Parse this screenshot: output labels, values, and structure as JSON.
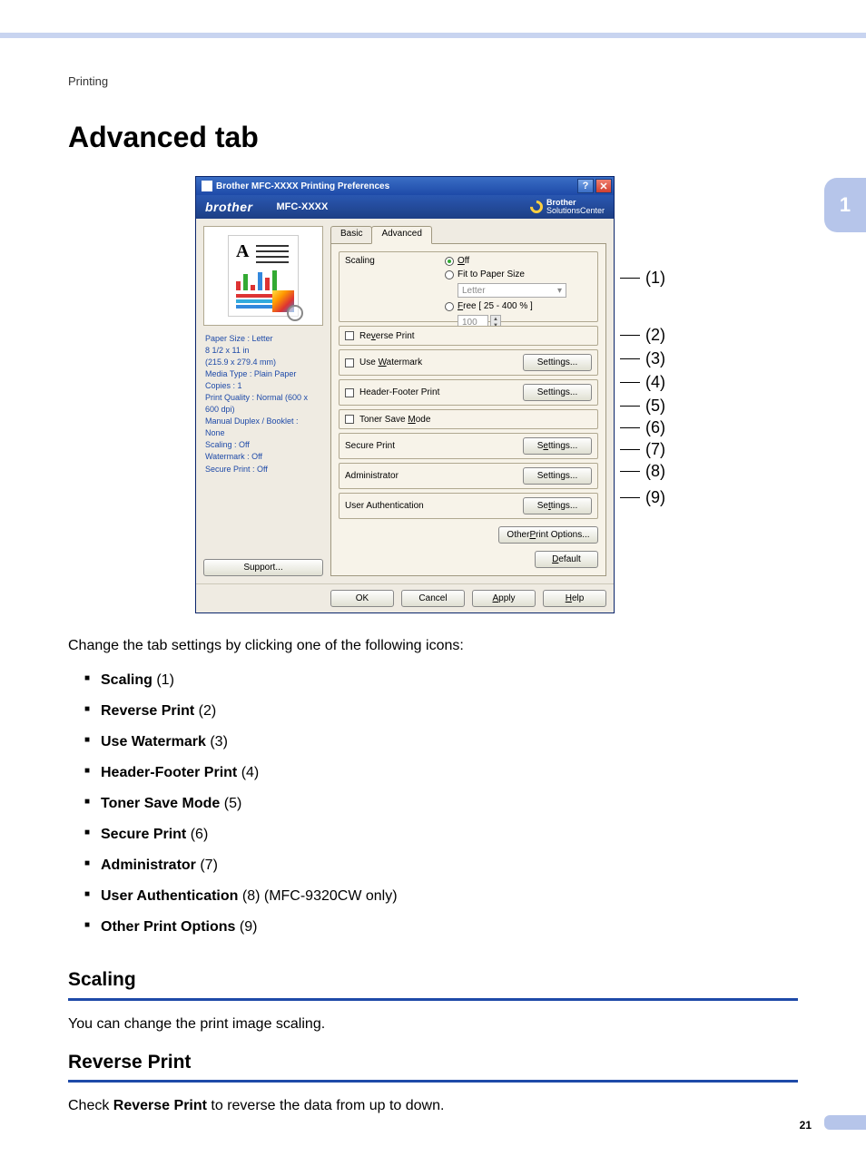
{
  "breadcrumb": "Printing",
  "heading": "Advanced tab",
  "side_chapter": "1",
  "page_number": "21",
  "window": {
    "title": "Brother MFC-XXXX Printing Preferences",
    "brand_left": "brother",
    "brand_mid": "MFC-XXXX",
    "brand_right_top": "Brother",
    "brand_right_bot": "SolutionsCenter",
    "tabs": {
      "basic": "Basic",
      "advanced": "Advanced"
    },
    "info": {
      "paper_size": "Paper Size : Letter",
      "dims": "8 1/2 x 11 in",
      "dims_mm": "(215.9 x 279.4 mm)",
      "media": "Media Type : Plain Paper",
      "copies": "Copies : 1",
      "quality": "Print Quality : Normal (600 x 600 dpi)",
      "duplex_lbl": "Manual Duplex / Booklet :",
      "duplex_val": "None",
      "scaling": "Scaling : Off",
      "watermark": "Watermark : Off",
      "secure": "Secure Print : Off"
    },
    "scaling": {
      "label": "Scaling",
      "off": "Off",
      "fit": "Fit to Paper Size",
      "fit_value": "Letter",
      "free": "Free [ 25 - 400 % ]",
      "free_value": "100"
    },
    "rows": {
      "reverse": "Reverse Print",
      "watermark": "Use Watermark",
      "headerfooter": "Header-Footer Print",
      "toner": "Toner Save Mode",
      "secure": "Secure Print",
      "admin": "Administrator",
      "userauth": "User Authentication"
    },
    "settings_btn": "Settings...",
    "other_options_btn": "Other Print Options...",
    "default_btn": "Default",
    "support_btn": "Support...",
    "footer": {
      "ok": "OK",
      "cancel": "Cancel",
      "apply": "Apply",
      "help": "Help"
    }
  },
  "callouts": {
    "c1": "(1)",
    "c2": "(2)",
    "c3": "(3)",
    "c4": "(4)",
    "c5": "(5)",
    "c6": "(6)",
    "c7": "(7)",
    "c8": "(8)",
    "c9": "(9)"
  },
  "intro": "Change the tab settings by clicking one of the following icons:",
  "list": {
    "i1b": "Scaling",
    "i1n": " (1)",
    "i2b": "Reverse Print",
    "i2n": " (2)",
    "i3b": "Use Watermark",
    "i3n": " (3)",
    "i4b": "Header-Footer Print",
    "i4n": " (4)",
    "i5b": "Toner Save Mode",
    "i5n": " (5)",
    "i6b": "Secure Print",
    "i6n": " (6)",
    "i7b": "Administrator",
    "i7n": " (7)",
    "i8b": "User Authentication",
    "i8n": " (8) (MFC-9320CW only)",
    "i9b": "Other Print Options",
    "i9n": " (9)"
  },
  "sections": {
    "scaling_h": "Scaling",
    "scaling_p": "You can change the print image scaling.",
    "reverse_h": "Reverse Print",
    "reverse_p1": "Check ",
    "reverse_pb": "Reverse Print",
    "reverse_p2": " to reverse the data from up to down."
  }
}
